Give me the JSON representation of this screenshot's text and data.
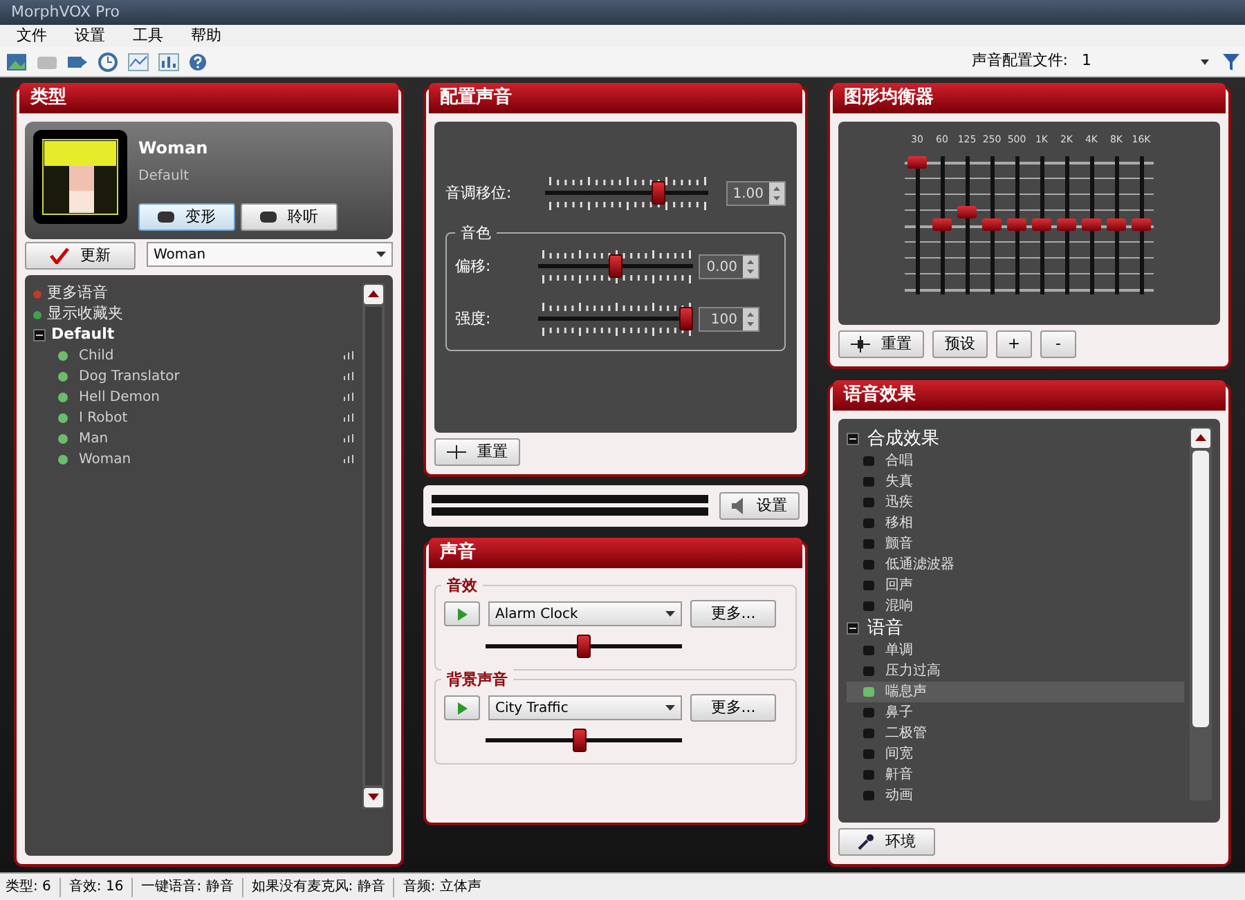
{
  "window": {
    "title": "MorphVOX Pro"
  },
  "menu": [
    "文件",
    "设置",
    "工具",
    "帮助"
  ],
  "toolbar": {
    "profile_label": "声音配置文件:",
    "profile_value": "1"
  },
  "voices_panel": {
    "title": "类型",
    "voice_name": "Woman",
    "voice_pack": "Default",
    "buttons": [
      {
        "label": "变形",
        "selected": true
      },
      {
        "label": "聆听",
        "selected": false
      }
    ],
    "update_button": "更新",
    "voice_select": "Woman",
    "list": [
      {
        "kind": "link",
        "label": "更多语音",
        "color": "#c0392b"
      },
      {
        "kind": "link",
        "label": "显示收藏夹",
        "color": "#3fa34d"
      },
      {
        "kind": "group",
        "label": "Default",
        "expanded": true,
        "children": [
          {
            "label": "Child"
          },
          {
            "label": "Dog Translator"
          },
          {
            "label": "Hell Demon"
          },
          {
            "label": "I Robot"
          },
          {
            "label": "Man"
          },
          {
            "label": "Woman"
          }
        ]
      }
    ]
  },
  "tweak_panel": {
    "title": "配置声音",
    "pitch": {
      "label": "音调移位:",
      "level": 0.72,
      "value": "1.00"
    },
    "timbre_group": "音色",
    "timbre": [
      {
        "label": "偏移:",
        "level": 0.5,
        "value": "0.00"
      },
      {
        "label": "强度:",
        "level": 1.0,
        "value": "100"
      }
    ],
    "reset_button": "重置"
  },
  "meter": {
    "settings_button": "设置"
  },
  "sounds_panel": {
    "title": "声音",
    "groups": [
      {
        "label": "音效",
        "selection": "Alarm Clock",
        "more_button": "更多...",
        "level": 0.5
      },
      {
        "label": "背景声音",
        "selection": "City Traffic",
        "more_button": "更多...",
        "level": 0.48
      }
    ]
  },
  "eq_panel": {
    "title": "图形均衡器",
    "bands": [
      {
        "label": "30",
        "level": 1.0
      },
      {
        "label": "60",
        "level": 0.5
      },
      {
        "label": "125",
        "level": 0.6
      },
      {
        "label": "250",
        "level": 0.5
      },
      {
        "label": "500",
        "level": 0.5
      },
      {
        "label": "1K",
        "level": 0.5
      },
      {
        "label": "2K",
        "level": 0.5
      },
      {
        "label": "4K",
        "level": 0.5
      },
      {
        "label": "8K",
        "level": 0.5
      },
      {
        "label": "16K",
        "level": 0.5
      }
    ],
    "buttons": [
      "重置",
      "预设",
      "+",
      "-"
    ]
  },
  "effects_panel": {
    "title": "语音效果",
    "groups": [
      {
        "label": "合成效果",
        "expanded": true,
        "children": [
          {
            "label": "合唱",
            "on": false,
            "selected": false
          },
          {
            "label": "失真",
            "on": false,
            "selected": false
          },
          {
            "label": "迅疾",
            "on": false,
            "selected": false
          },
          {
            "label": "移相",
            "on": false,
            "selected": false
          },
          {
            "label": "颤音",
            "on": false,
            "selected": false
          },
          {
            "label": "低通滤波器",
            "on": false,
            "selected": false
          },
          {
            "label": "回声",
            "on": false,
            "selected": false
          },
          {
            "label": "混响",
            "on": false,
            "selected": false
          }
        ]
      },
      {
        "label": "语音",
        "expanded": true,
        "children": [
          {
            "label": "单调",
            "on": false,
            "selected": false
          },
          {
            "label": "压力过高",
            "on": false,
            "selected": false
          },
          {
            "label": "喘息声",
            "on": true,
            "selected": true
          },
          {
            "label": "鼻子",
            "on": false,
            "selected": false
          },
          {
            "label": "二极管",
            "on": false,
            "selected": false
          },
          {
            "label": "间宽",
            "on": false,
            "selected": false
          },
          {
            "label": "鼾音",
            "on": false,
            "selected": false
          },
          {
            "label": "动画",
            "on": false,
            "selected": false
          }
        ]
      }
    ],
    "tweak_button": "环境"
  },
  "status_bar": [
    "类型: 6",
    "音效: 16",
    "一键语音: 静音",
    "如果没有麦克风: 静音",
    "音频: 立体声"
  ]
}
